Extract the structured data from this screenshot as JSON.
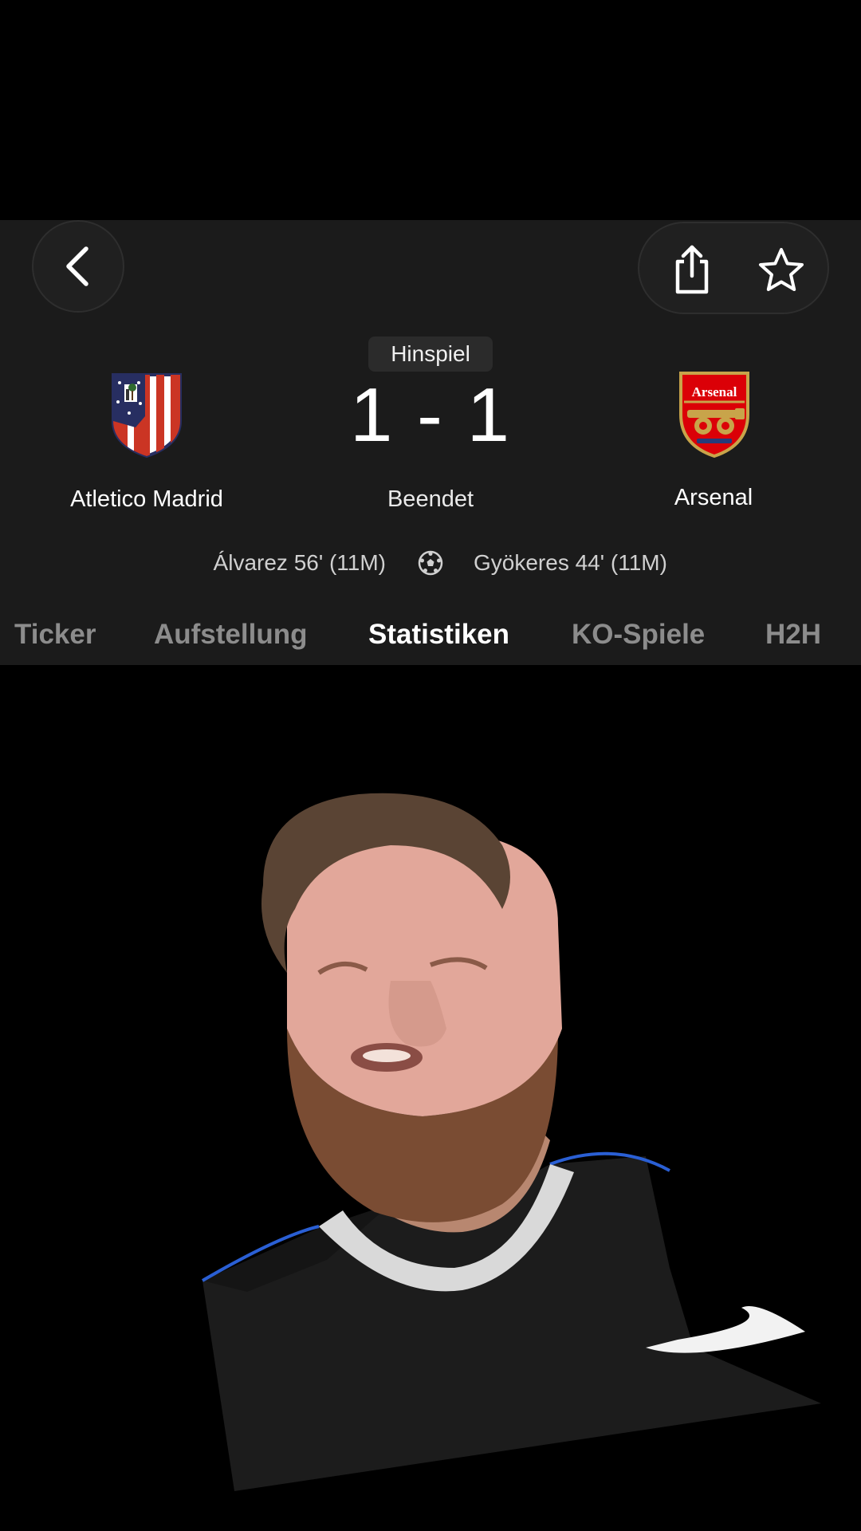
{
  "header": {
    "back_icon": "chevron-left-icon",
    "share_icon": "share-icon",
    "favorite_icon": "star-icon"
  },
  "match": {
    "leg_label": "Hinspiel",
    "score": "1 - 1",
    "status": "Beendet",
    "home_team": {
      "name": "Atletico Madrid",
      "logo": "atletico-madrid-crest"
    },
    "away_team": {
      "name": "Arsenal",
      "logo": "arsenal-crest",
      "crest_text": "Arsenal"
    },
    "home_scorer": "Álvarez 56' (11M)",
    "away_scorer": "Gyökeres 44' (11M)",
    "goal_icon": "soccer-ball-icon"
  },
  "tabs": [
    {
      "label": "Ticker",
      "active": false
    },
    {
      "label": "Aufstellung",
      "active": false
    },
    {
      "label": "Statistiken",
      "active": true
    },
    {
      "label": "KO-Spiele",
      "active": false
    },
    {
      "label": "H2H",
      "active": false
    }
  ],
  "colors": {
    "panel_bg": "#1b1b1b",
    "tab_inactive": "#8c8c8c",
    "tab_active": "#ffffff",
    "arsenal_red": "#db0007",
    "atletico_red": "#cb3524",
    "atletico_blue": "#272e61"
  }
}
